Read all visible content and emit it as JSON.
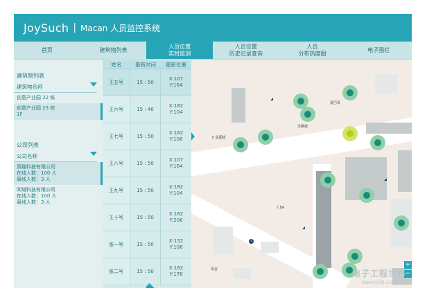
{
  "header": {
    "logo": "JoySuch",
    "system_title": "Macan 人员监控系统"
  },
  "nav": {
    "items": [
      {
        "label": "首页",
        "active": false
      },
      {
        "label": "建筑物列表",
        "active": false
      },
      {
        "label": "人员位置\n实时监测",
        "active": true
      },
      {
        "label": "人员位置\n历史记录查询",
        "active": false
      },
      {
        "label": "人员\n分布热度图",
        "active": false
      },
      {
        "label": "电子围栏",
        "active": false
      }
    ]
  },
  "sidebar": {
    "building_section": {
      "title": "建筑物列表",
      "select_label": "建筑物名称",
      "items": [
        "创意产业园 22 栋",
        "创意产业园 23 栋",
        "1F"
      ]
    },
    "company_section": {
      "title": "公司列表",
      "select_label": "公司名称",
      "companies": [
        {
          "name": "真趣科技有限公司",
          "online": "在线人数：100 人",
          "offline": "离线人数：3 人"
        },
        {
          "name": "同城科技有限公司",
          "online": "在线人数：100 人",
          "offline": "离线人数：3 人"
        }
      ]
    }
  },
  "table": {
    "headers": [
      "姓名",
      "最新时间",
      "最新位置"
    ],
    "rows": [
      {
        "name": "王五号",
        "time": "15 : 50",
        "pos": "X:107\nY:164"
      },
      {
        "name": "王六号",
        "time": "15 : 40",
        "pos": "X:182\nY:104"
      },
      {
        "name": "王七号",
        "time": "15 : 50",
        "pos": "X:162\nY:106"
      },
      {
        "name": "王八号",
        "time": "15 : 50",
        "pos": "X:107\nY:164"
      },
      {
        "name": "王九号",
        "time": "15 : 50",
        "pos": "X:182\nY:104"
      },
      {
        "name": "王十号",
        "time": "15 : 50",
        "pos": "X:162\nY:206"
      },
      {
        "name": "张一号",
        "time": "15 : 50",
        "pos": "X:152\nY:106"
      },
      {
        "name": "张二号",
        "time": "15 : 50",
        "pos": "X:162\nY:176"
      }
    ]
  },
  "map": {
    "pois": [
      "夏巴哥",
      "沃腾德",
      "E 黑图纸",
      "CBA",
      "毒谷"
    ],
    "zoom_in": "+",
    "zoom_out": "−"
  },
  "watermark": {
    "main": "电子工程世界",
    "sub": "eeworld.com.cn"
  },
  "colors": {
    "accent": "#27a5b6",
    "marker": "#1d8b7a",
    "marker_active": "#bccb18"
  }
}
